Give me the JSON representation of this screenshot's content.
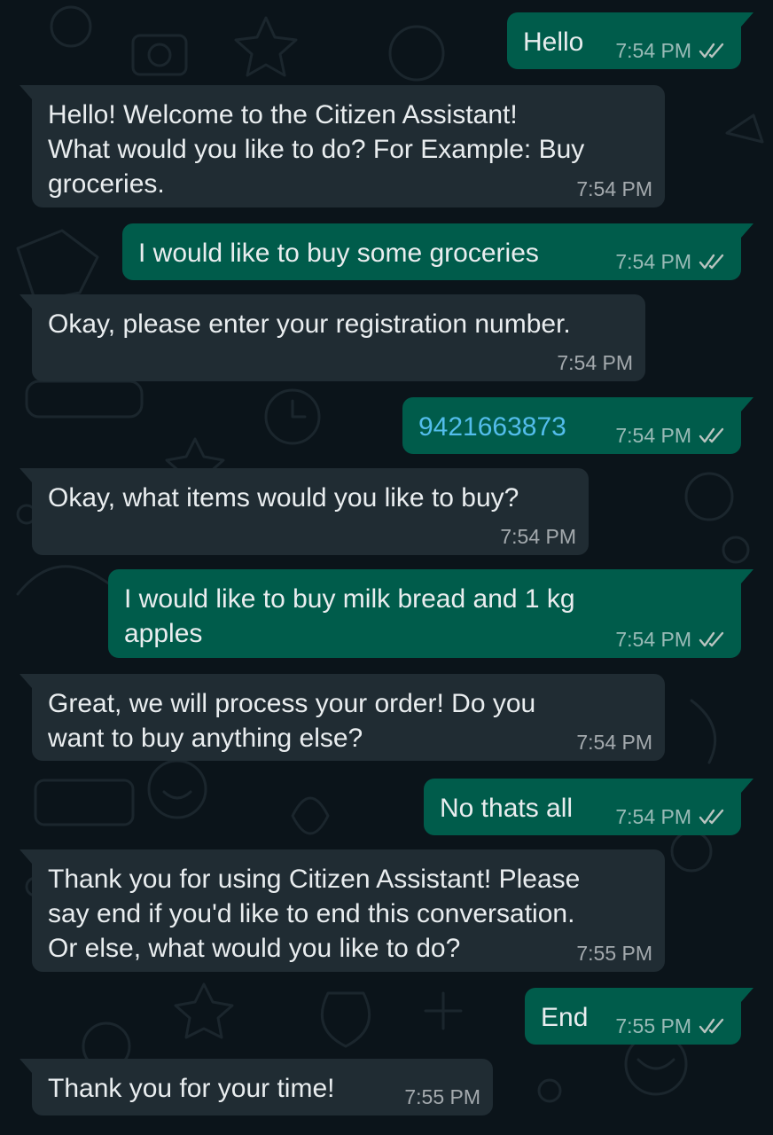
{
  "colors": {
    "background": "#0b141a",
    "incoming_bubble": "#202c33",
    "outgoing_bubble": "#005c4b",
    "link": "#53bdeb",
    "tick": "#b9c4c0"
  },
  "messages": [
    {
      "dir": "out",
      "text": "Hello",
      "time": "7:54 PM",
      "status": "read-ticks-icon"
    },
    {
      "dir": "in",
      "text": "Hello! Welcome to the Citizen Assistant!\nWhat would you like to do? For Example: Buy\ngroceries.",
      "time": "7:54 PM"
    },
    {
      "dir": "out",
      "text": "I would like to buy some groceries",
      "time": "7:54 PM",
      "status": "read-ticks-icon"
    },
    {
      "dir": "in",
      "text": "Okay, please enter your registration number.",
      "time": "7:54 PM"
    },
    {
      "dir": "out",
      "text": "9421663873",
      "time": "7:54 PM",
      "status": "read-ticks-icon"
    },
    {
      "dir": "in",
      "text": "Okay, what items would you like to buy?",
      "time": "7:54 PM"
    },
    {
      "dir": "out",
      "text": "I would like to buy milk bread and 1 kg\napples",
      "time": "7:54 PM",
      "status": "read-ticks-icon"
    },
    {
      "dir": "in",
      "text": "Great, we will process your order! Do you\nwant to buy anything else?",
      "time": "7:54 PM"
    },
    {
      "dir": "out",
      "text": "No thats all",
      "time": "7:54 PM",
      "status": "read-ticks-icon"
    },
    {
      "dir": "in",
      "text": "Thank you for using Citizen Assistant! Please\nsay end if you'd like to end this conversation.\nOr else, what would you like to do?",
      "time": "7:55 PM"
    },
    {
      "dir": "out",
      "text": "End",
      "time": "7:55 PM",
      "status": "read-ticks-icon"
    },
    {
      "dir": "in",
      "text": "Thank you for your time!",
      "time": "7:55 PM"
    }
  ]
}
